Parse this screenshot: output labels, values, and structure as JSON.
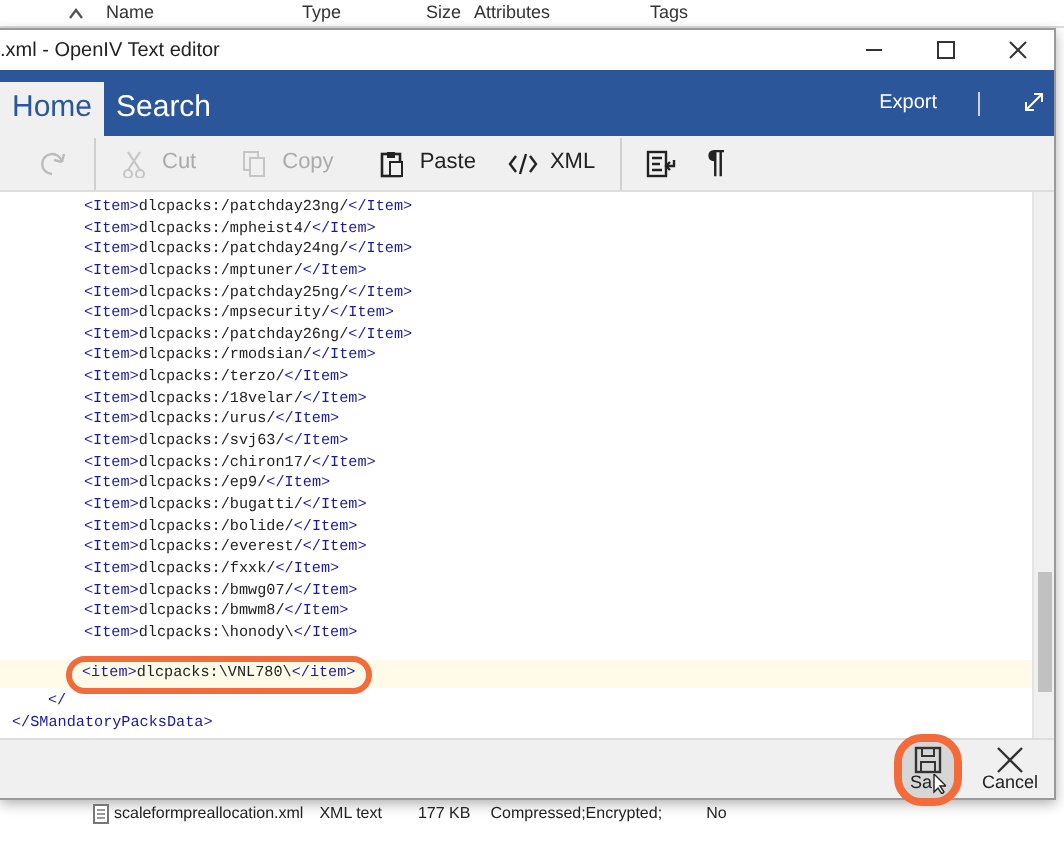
{
  "background_list": {
    "columns": [
      "Name",
      "Type",
      "Size",
      "Attributes",
      "Tags"
    ],
    "rows": [
      {
        "name": "scaleformpreallocation.xml",
        "type": "XML text",
        "size": "177 KB",
        "attributes": "Compressed;Encrypted;",
        "tags": "No"
      }
    ]
  },
  "window": {
    "title": ".xml - OpenIV Text editor"
  },
  "tabs": [
    {
      "label": "Home",
      "selected": true
    },
    {
      "label": "Search",
      "selected": false
    }
  ],
  "ribbon_actions": [
    "Export"
  ],
  "toolbar": [
    {
      "kind": "redo",
      "disabled": true
    },
    {
      "kind": "cut",
      "label": "Cut",
      "disabled": true
    },
    {
      "kind": "copy",
      "label": "Copy",
      "disabled": true
    },
    {
      "kind": "paste",
      "label": "Paste",
      "disabled": false
    },
    {
      "kind": "xml",
      "label": "XML",
      "disabled": false
    },
    {
      "kind": "format",
      "disabled": false
    },
    {
      "kind": "pilcrow",
      "label": "¶",
      "disabled": false
    }
  ],
  "editor_lines": [
    {
      "kind": "item",
      "text": "<Item>dlcpacks:/patchday23ng/</Item>",
      "highlighted": false
    },
    {
      "kind": "item",
      "text": "<Item>dlcpacks:/mpheist4/</Item>",
      "highlighted": false
    },
    {
      "kind": "item",
      "text": "<Item>dlcpacks:/patchday24ng/</Item>",
      "highlighted": false
    },
    {
      "kind": "item",
      "text": "<Item>dlcpacks:/mptuner/</Item>",
      "highlighted": false
    },
    {
      "kind": "item",
      "text": "<Item>dlcpacks:/patchday25ng/</Item>",
      "highlighted": false
    },
    {
      "kind": "item",
      "text": "<Item>dlcpacks:/mpsecurity/</Item>",
      "highlighted": false
    },
    {
      "kind": "item",
      "text": "<Item>dlcpacks:/patchday26ng/</Item>",
      "highlighted": false
    },
    {
      "kind": "item",
      "text": "<Item>dlcpacks:/rmodsian/</Item>",
      "highlighted": false
    },
    {
      "kind": "item",
      "text": "<Item>dlcpacks:/terzo/</Item>",
      "highlighted": false
    },
    {
      "kind": "item",
      "text": "<Item>dlcpacks:/18velar/</Item>",
      "highlighted": false
    },
    {
      "kind": "item",
      "text": "<Item>dlcpacks:/urus/</Item>",
      "highlighted": false
    },
    {
      "kind": "item",
      "text": "<Item>dlcpacks:/svj63/</Item>",
      "highlighted": false
    },
    {
      "kind": "item",
      "text": "<Item>dlcpacks:/chiron17/</Item>",
      "highlighted": false
    },
    {
      "kind": "item",
      "text": "<Item>dlcpacks:/ep9/</Item>",
      "highlighted": false
    },
    {
      "kind": "item",
      "text": "<Item>dlcpacks:/bugatti/</Item>",
      "highlighted": false
    },
    {
      "kind": "item",
      "text": "<Item>dlcpacks:/bolide/</Item>",
      "highlighted": false
    },
    {
      "kind": "item",
      "text": "<Item>dlcpacks:/everest/</Item>",
      "highlighted": false
    },
    {
      "kind": "item",
      "text": "<Item>dlcpacks:/fxxk/</Item>",
      "highlighted": false
    },
    {
      "kind": "item",
      "text": "<Item>dlcpacks:/bmwg07/</Item>",
      "highlighted": false
    },
    {
      "kind": "item",
      "text": "<Item>dlcpacks:/bmwm8/</Item>",
      "highlighted": false
    },
    {
      "kind": "item",
      "text": "<Item>dlcpacks:\\honody\\</Item>",
      "highlighted": false
    },
    {
      "kind": "item",
      "text": "<item>dlcpacks:\\VNL780\\</item>",
      "highlighted": true
    },
    {
      "kind": "parent-close",
      "text": "</",
      "highlighted": false
    },
    {
      "kind": "root-close",
      "text": "</SMandatoryPacksData>",
      "highlighted": false
    }
  ],
  "footer_buttons": [
    {
      "kind": "save",
      "label": "Sa",
      "highlighted": true
    },
    {
      "kind": "cancel",
      "label": "Cancel",
      "highlighted": false
    }
  ]
}
